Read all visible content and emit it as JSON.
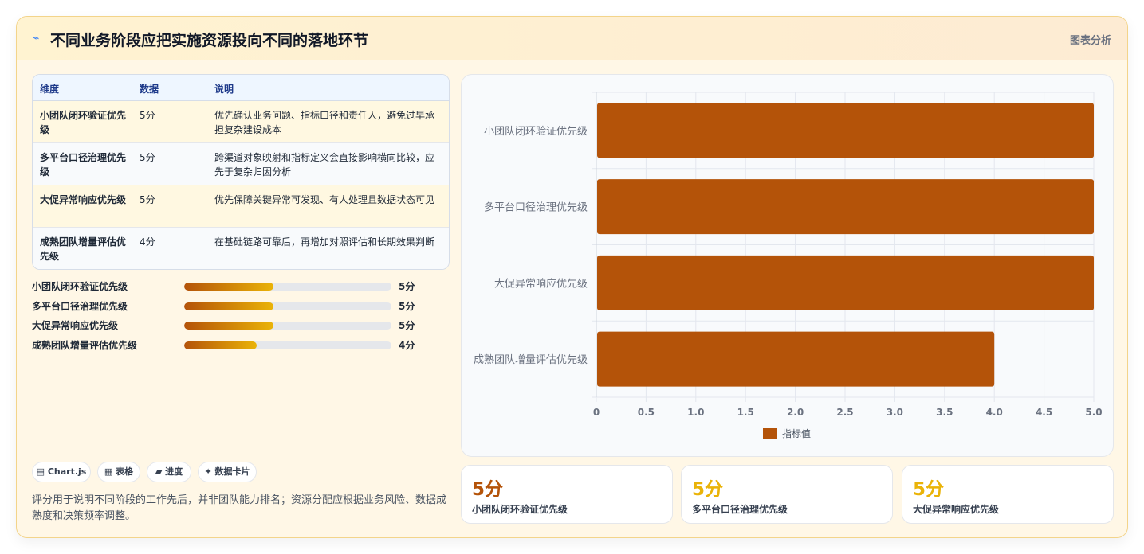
{
  "header": {
    "title": "不同业务阶段应把实施资源投向不同的落地环节",
    "tag": "图表分析"
  },
  "table": {
    "headers": [
      "维度",
      "数据",
      "说明"
    ],
    "rows": [
      {
        "dim": "小团队闭环验证优先级",
        "data": "5分",
        "desc": "优先确认业务问题、指标口径和责任人，避免过早承担复杂建设成本"
      },
      {
        "dim": "多平台口径治理优先级",
        "data": "5分",
        "desc": "跨渠道对象映射和指标定义会直接影响横向比较，应先于复杂归因分析"
      },
      {
        "dim": "大促异常响应优先级",
        "data": "5分",
        "desc": "优先保障关键异常可发现、有人处理且数据状态可见"
      },
      {
        "dim": "成熟团队增量评估优先级",
        "data": "4分",
        "desc": "在基础链路可靠后，再增加对照评估和长期效果判断"
      }
    ]
  },
  "progress": [
    {
      "label": "小团队闭环验证优先级",
      "value": 5,
      "text": "5分",
      "pct": 0.43
    },
    {
      "label": "多平台口径治理优先级",
      "value": 5,
      "text": "5分",
      "pct": 0.43
    },
    {
      "label": "大促异常响应优先级",
      "value": 5,
      "text": "5分",
      "pct": 0.43
    },
    {
      "label": "成熟团队增量评估优先级",
      "value": 4,
      "text": "4分",
      "pct": 0.35
    }
  ],
  "chips": [
    "▤ Chart.js",
    "▦ 表格",
    "▰ 进度",
    "✦ 数据卡片"
  ],
  "note": "评分用于说明不同阶段的工作先后，并非团队能力排名；资源分配应根据业务风险、数据成熟度和决策频率调整。",
  "kpis": [
    {
      "value": "5分",
      "label": "小团队闭环验证优先级",
      "color": "#b45309"
    },
    {
      "value": "5分",
      "label": "多平台口径治理优先级",
      "color": "#eab308"
    },
    {
      "value": "5分",
      "label": "大促异常响应优先级",
      "color": "#eab308"
    }
  ],
  "chart_data": {
    "type": "bar",
    "orientation": "horizontal",
    "categories": [
      "小团队闭环验证优先级",
      "多平台口径治理优先级",
      "大促异常响应优先级",
      "成熟团队增量评估优先级"
    ],
    "series": [
      {
        "name": "指标值",
        "values": [
          5,
          5,
          5,
          4
        ]
      }
    ],
    "xlim": [
      0,
      5
    ],
    "xticks": [
      "0",
      "0.5",
      "1.0",
      "1.5",
      "2.0",
      "2.5",
      "3.0",
      "3.5",
      "4.0",
      "4.5",
      "5.0"
    ],
    "bar_color": "#b45309",
    "grid": true,
    "legend": "bottom"
  }
}
